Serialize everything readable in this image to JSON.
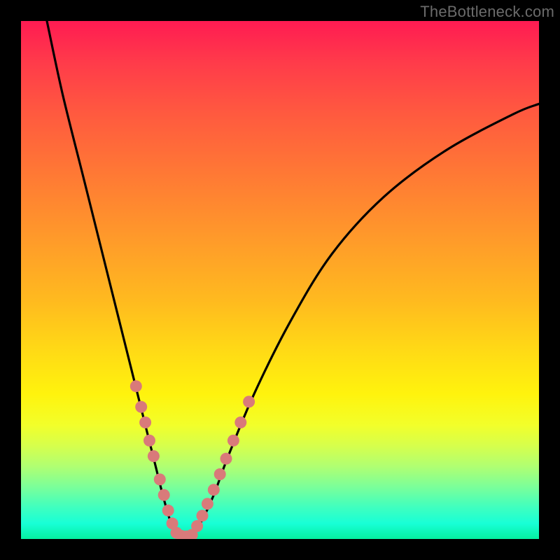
{
  "watermark": "TheBottleneck.com",
  "chart_data": {
    "type": "line",
    "title": "",
    "xlabel": "",
    "ylabel": "",
    "xlim": [
      0,
      100
    ],
    "ylim": [
      0,
      100
    ],
    "series": [
      {
        "name": "bottleneck-curve",
        "x": [
          5,
          8,
          12,
          16,
          19,
          22,
          24,
          26,
          27.5,
          29,
          30.5,
          32,
          34,
          37,
          40,
          45,
          52,
          60,
          70,
          82,
          95,
          100
        ],
        "y": [
          100,
          86,
          70,
          54,
          42,
          30,
          22,
          14,
          8,
          3,
          0.5,
          0.5,
          2,
          8,
          16,
          28,
          42,
          55,
          66,
          75,
          82,
          84
        ]
      }
    ],
    "markers_left": {
      "name": "left-dots",
      "x": [
        22.2,
        23.2,
        24.0,
        24.8,
        25.6,
        26.8,
        27.6,
        28.4,
        29.2,
        30.0,
        31.0,
        32.0,
        33.0
      ],
      "y": [
        29.5,
        25.5,
        22.5,
        19.0,
        16.0,
        11.5,
        8.5,
        5.5,
        3.0,
        1.2,
        0.6,
        0.5,
        0.8
      ]
    },
    "markers_right": {
      "name": "right-dots",
      "x": [
        34.0,
        35.0,
        36.0,
        37.2,
        38.4,
        39.6,
        41.0,
        42.4,
        44.0
      ],
      "y": [
        2.5,
        4.5,
        6.8,
        9.5,
        12.5,
        15.5,
        19.0,
        22.5,
        26.5
      ]
    },
    "colors": {
      "curve": "#000000",
      "dot_fill": "#d97a7a",
      "dot_stroke": "#b95a5a"
    }
  }
}
